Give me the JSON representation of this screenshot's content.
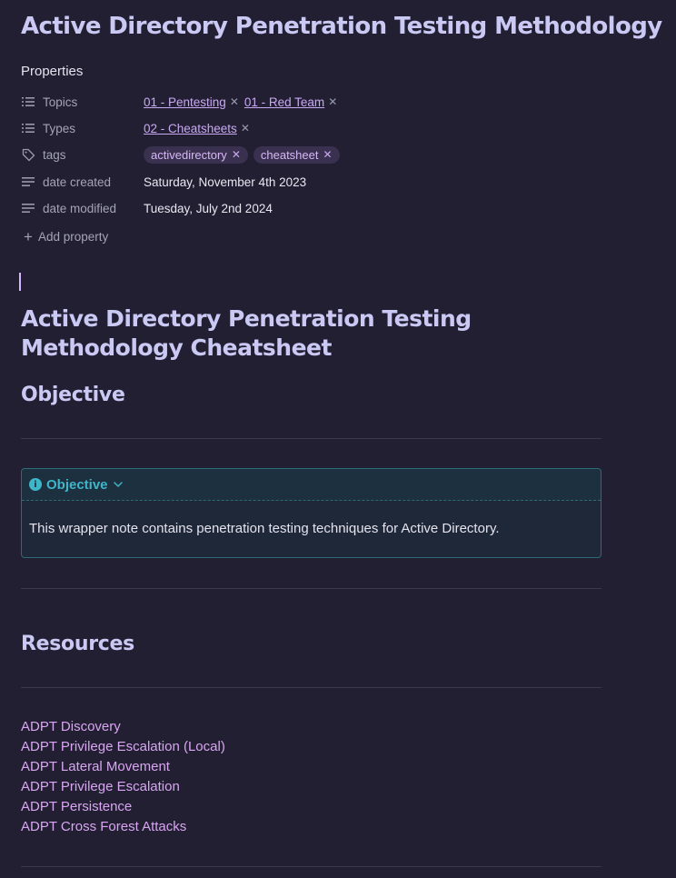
{
  "note_title": "Active Directory Penetration Testing Methodology",
  "properties": {
    "heading": "Properties",
    "topics": {
      "key": "Topics",
      "links": [
        "01 - Pentesting",
        "01 - Red Team"
      ]
    },
    "types": {
      "key": "Types",
      "links": [
        "02 - Cheatsheets"
      ]
    },
    "tags": {
      "key": "tags",
      "values": [
        "activedirectory",
        "cheatsheet"
      ]
    },
    "date_created": {
      "key": "date created",
      "value": "Saturday, November 4th 2023"
    },
    "date_modified": {
      "key": "date modified",
      "value": "Tuesday, July 2nd 2024"
    },
    "add_label": "Add property"
  },
  "content": {
    "main_heading": "Active Directory Penetration Testing Methodology Cheatsheet",
    "objective_heading": "Objective",
    "callout": {
      "title": "Objective",
      "body": "This wrapper note contains penetration testing techniques for Active Directory."
    },
    "resources_heading": "Resources",
    "resources": [
      "ADPT Discovery",
      "ADPT Privilege Escalation (Local)",
      "ADPT Lateral Movement",
      "ADPT Privilege Escalation",
      "ADPT Persistence",
      "ADPT Cross Forest Attacks"
    ]
  },
  "icons": {
    "list": "list-icon",
    "tag": "tag-icon",
    "text": "text-lines-icon",
    "plus": "plus-icon",
    "info": "info-icon",
    "chevron": "chevron-down-icon"
  },
  "colors": {
    "background": "#221f33",
    "heading": "#c9c9f4",
    "link": "#d9a6f2",
    "callout_accent": "#3fb6c8"
  }
}
